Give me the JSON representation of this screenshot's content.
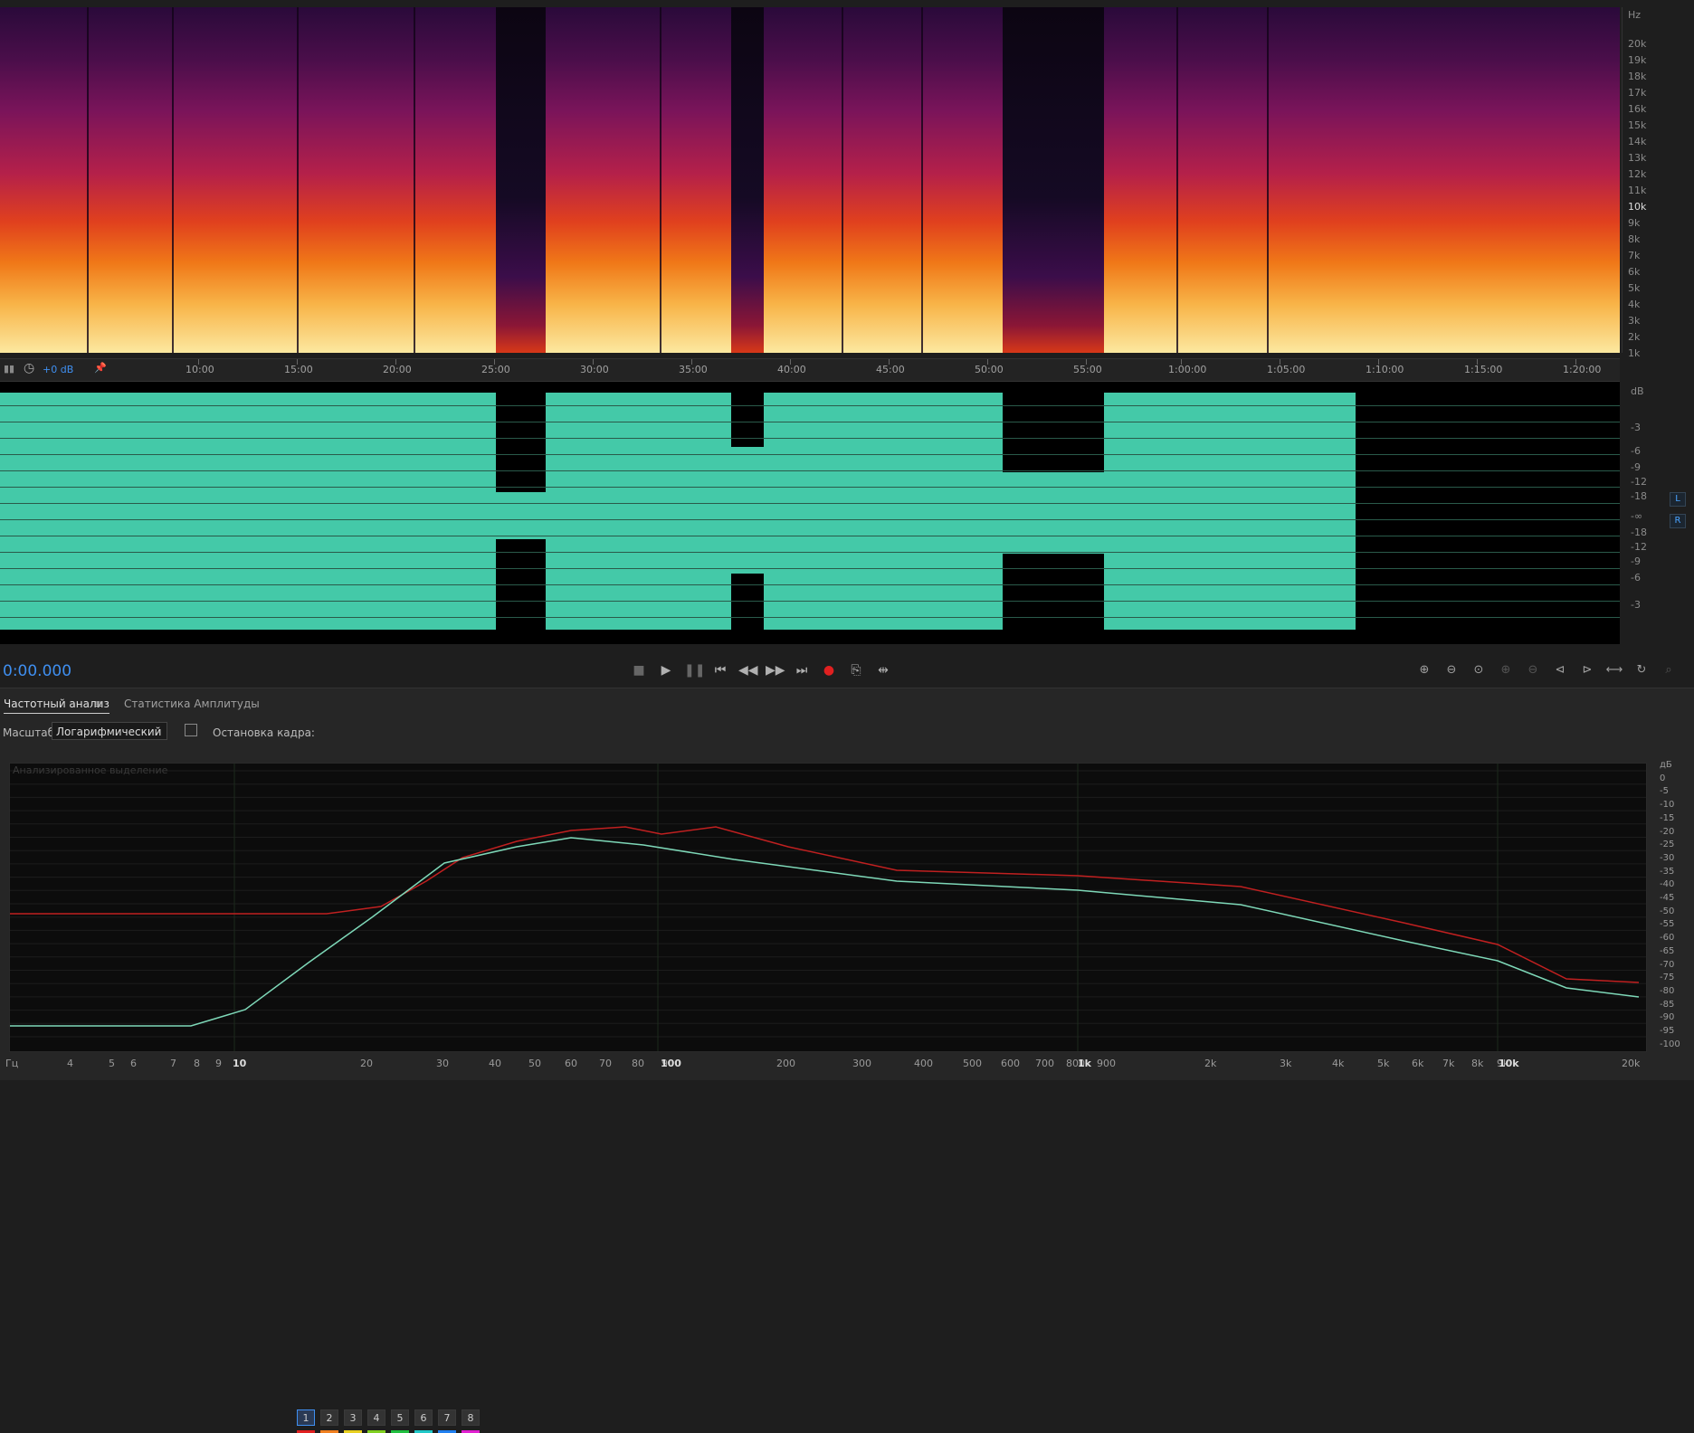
{
  "spectrogram": {
    "hz_labels": [
      "Hz",
      "20k",
      "19k",
      "18k",
      "17k",
      "16k",
      "15k",
      "14k",
      "13k",
      "12k",
      "11k",
      "10k",
      "9k",
      "8k",
      "7k",
      "6k",
      "5k",
      "4k",
      "3k",
      "2k",
      "1k"
    ]
  },
  "timeline": {
    "gain": "+0 dB",
    "labels": [
      "10:00",
      "15:00",
      "20:00",
      "25:00",
      "30:00",
      "35:00",
      "40:00",
      "45:00",
      "50:00",
      "55:00",
      "1:00:00",
      "1:05:00",
      "1:10:00",
      "1:15:00",
      "1:20:00"
    ]
  },
  "waveform": {
    "db_labels": [
      "dB",
      "-3",
      "-6",
      "-9",
      "-12",
      "-18",
      "-∞",
      "-18",
      "-12",
      "-9",
      "-6",
      "-3"
    ],
    "channels": [
      "L",
      "R"
    ]
  },
  "transport": {
    "timecode": "0:00.000",
    "buttons": [
      "stop-icon",
      "play-icon",
      "pause-icon",
      "skip-back-icon",
      "rewind-icon",
      "fast-forward-icon",
      "skip-forward-icon",
      "record-icon",
      "loop-icon",
      "skip-selection-icon"
    ]
  },
  "panel": {
    "tabs": [
      "Частотный анализ",
      "Статистика Амплитуды"
    ],
    "scale_label": "Масштаб:",
    "scale_value": "Логарифмический",
    "freeze_label": "Остановка кадра:",
    "freeze_buttons": [
      "1",
      "2",
      "3",
      "4",
      "5",
      "6",
      "7",
      "8"
    ],
    "freeze_colors": [
      "#e02020",
      "#f08020",
      "#e8d020",
      "#80d020",
      "#20c040",
      "#20c8c8",
      "#2080f0",
      "#e020d0"
    ],
    "graph_title": "Анализированное выделение",
    "freq_labels": [
      "Гц",
      "4",
      "5",
      "6",
      "7",
      "8",
      "9",
      "10",
      "20",
      "30",
      "40",
      "50",
      "60",
      "70",
      "80",
      "90",
      "100",
      "200",
      "300",
      "400",
      "500",
      "600",
      "700",
      "800",
      "900",
      "1k",
      "2k",
      "3k",
      "4k",
      "5k",
      "6k",
      "7k",
      "8k",
      "9k",
      "10k",
      "20k"
    ],
    "db_labels": [
      "дБ",
      "0",
      "-5",
      "-10",
      "-15",
      "-20",
      "-25",
      "-30",
      "-35",
      "-40",
      "-45",
      "-50",
      "-55",
      "-60",
      "-65",
      "-70",
      "-75",
      "-80",
      "-85",
      "-90",
      "-95",
      "-100"
    ]
  },
  "colors": {
    "waveform": "#44c9a8",
    "timecode": "#3f8ff0",
    "curve_peak": "#c02020",
    "curve_avg": "#7ed8b8"
  }
}
